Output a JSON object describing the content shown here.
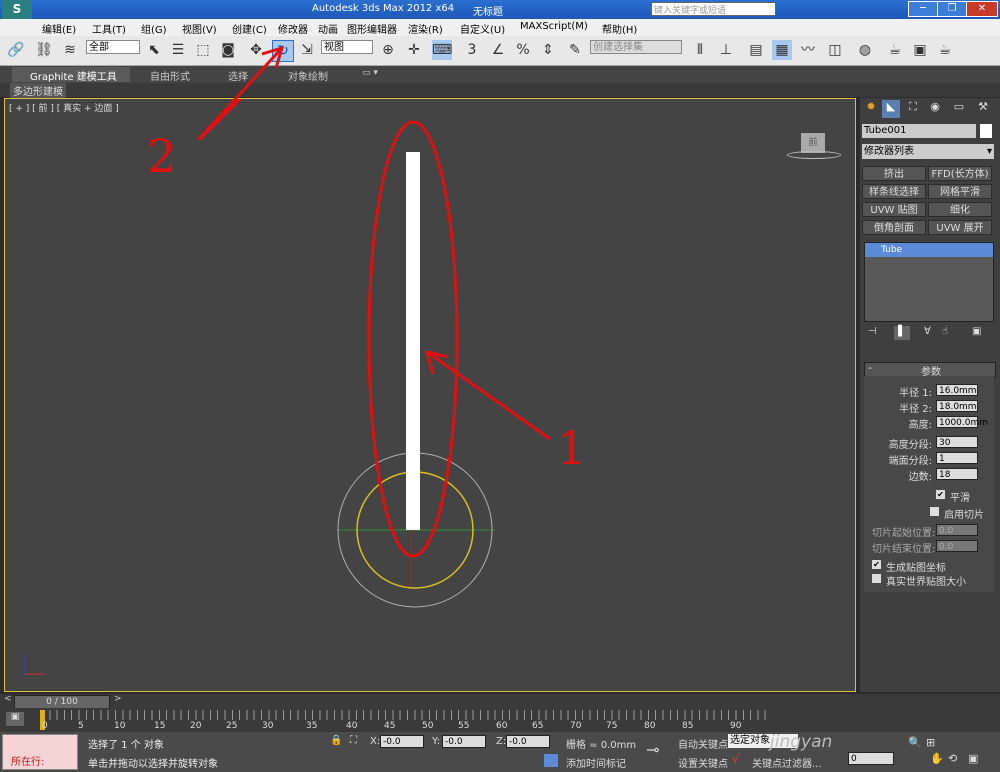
{
  "title_bar": {
    "title": "Autodesk 3ds Max  2012 x64",
    "filename": "无标题",
    "search_placeholder": "键入关键字或短语"
  },
  "menus": [
    "编辑(E)",
    "工具(T)",
    "组(G)",
    "视图(V)",
    "创建(C)",
    "修改器",
    "动画",
    "图形编辑器",
    "渲染(R)",
    "自定义(U)",
    "MAXScript(M)",
    "帮助(H)"
  ],
  "toolbar": {
    "selection_filter": "全部",
    "ref_coord": "视图",
    "named_selection_placeholder": "创建选择集"
  },
  "ribbon": {
    "tabs": [
      "Graphite 建模工具",
      "自由形式",
      "选择",
      "对象绘制"
    ],
    "subtab": "多边形建模"
  },
  "viewport": {
    "label": "[ + ] [ 前 ] [ 真实 + 边面 ]",
    "viewcube_label": "前"
  },
  "annotations": {
    "one": "1",
    "two": "2"
  },
  "command_panel": {
    "object_name": "Tube001",
    "modifier_list": "修改器列表",
    "modifier_buttons": [
      "挤出",
      "FFD(长方体)",
      "样条线选择",
      "网格平滑",
      "UVW 贴图",
      "细化",
      "倒角剖面",
      "UVW 展开"
    ],
    "stack_item": "Tube",
    "params_title": "参数",
    "params": [
      {
        "label": "半径 1:",
        "value": "16.0mm"
      },
      {
        "label": "半径 2:",
        "value": "18.0mm"
      },
      {
        "label": "高度:",
        "value": "1000.0mm"
      },
      {
        "label": "高度分段:",
        "value": "30"
      },
      {
        "label": "端面分段:",
        "value": "1"
      },
      {
        "label": "边数:",
        "value": "18"
      }
    ],
    "smooth_label": "平滑",
    "slice_on_label": "启用切片",
    "slice_from_label": "切片起始位置:",
    "slice_from_value": "0.0",
    "slice_to_label": "切片结束位置:",
    "slice_to_value": "0.0",
    "gen_map_label": "生成贴图坐标",
    "real_world_label": "真实世界贴图大小"
  },
  "timeline": {
    "frame_display": "0 / 100",
    "ticks": [
      "0",
      "5",
      "10",
      "15",
      "20",
      "25",
      "30",
      "35",
      "40",
      "45",
      "50",
      "55",
      "60",
      "65",
      "70",
      "75",
      "80",
      "85",
      "90"
    ]
  },
  "status": {
    "current": "所在行:",
    "selection_info": "选择了 1 个 对象",
    "prompt": "单击并拖动以选择并旋转对象",
    "x_label": "X:",
    "x_value": "-0.0",
    "y_label": "Y:",
    "y_value": "-0.0",
    "z_label": "Z:",
    "z_value": "-0.0",
    "grid": "栅格 = 0.0mm",
    "add_time_tag": "添加时间标记",
    "auto_key": "自动关键点",
    "set_key": "设置关键点",
    "selected_obj": "选定对象",
    "key_filters": "关键点过滤器...",
    "frame_value": "0",
    "watermark": "jingyan"
  }
}
